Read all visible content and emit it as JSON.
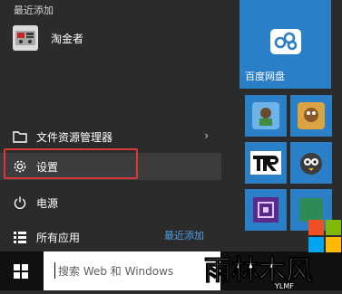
{
  "start_menu": {
    "section_title": "最近添加",
    "recent_app": {
      "label": "淘金者",
      "icon": "game-app-icon"
    },
    "items": [
      {
        "label": "文件资源管理器",
        "icon": "folder-icon",
        "chevron": "›"
      },
      {
        "label": "设置",
        "icon": "gear-icon"
      },
      {
        "label": "电源",
        "icon": "power-icon"
      },
      {
        "label": "所有应用",
        "icon": "list-icon"
      }
    ],
    "recent_link": "最近添加"
  },
  "tiles": [
    {
      "label": "百度网盘",
      "icon": "baidu-cloud-icon"
    },
    {
      "label": "",
      "icon": "game-tile-1"
    },
    {
      "label": "",
      "icon": "game-tile-2"
    },
    {
      "label": "",
      "icon": "tr-tile"
    },
    {
      "label": "",
      "icon": "bird-tile"
    },
    {
      "label": "",
      "icon": "purple-app-tile"
    },
    {
      "label": "",
      "icon": "green-app-tile"
    }
  ],
  "taskbar": {
    "search_placeholder": "搜索 Web 和 Windows"
  },
  "watermark": {
    "text": "雨林木风",
    "sub": "YLMF"
  },
  "colors": {
    "accent": "#2a7fc6",
    "highlight_border": "#d83a3a",
    "link": "#4ea0e8"
  }
}
